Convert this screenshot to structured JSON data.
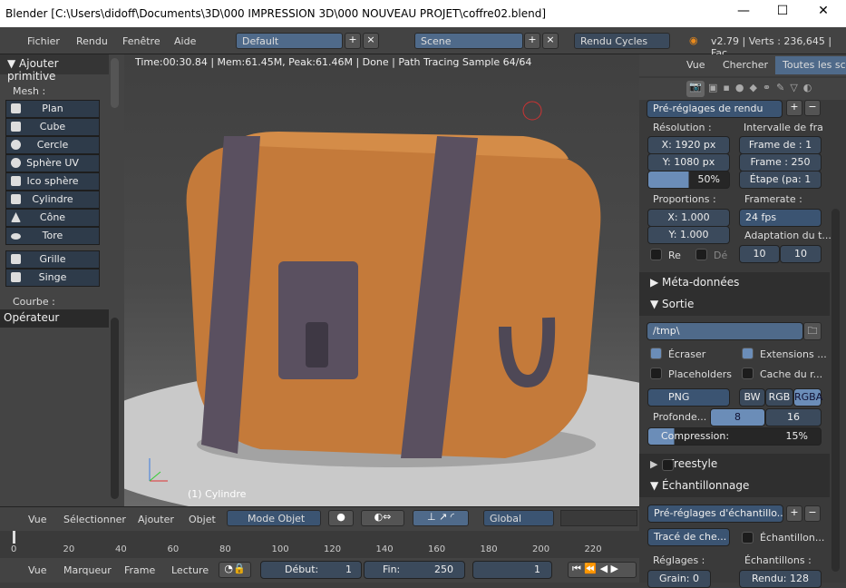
{
  "window": {
    "title": "Blender [C:\\Users\\didoff\\Documents\\3D\\000 IMPRESSION 3D\\000 NOUVEAU PROJET\\coffre02.blend]",
    "minimize": "—",
    "maximize": "☐",
    "close": "✕"
  },
  "topbar": {
    "menus": [
      "Fichier",
      "Rendu",
      "Fenêtre",
      "Aide"
    ],
    "layout": "Default",
    "scene": "Scene",
    "engine": "Rendu Cycles",
    "stats": "v2.79 | Verts : 236,645 | Fac"
  },
  "toolshelf": {
    "title": "▼ Ajouter primitive",
    "mesh_label": "Mesh :",
    "mesh_items": [
      "Plan",
      "Cube",
      "Cercle",
      "Sphère UV",
      "Ico sphère",
      "Cylindre",
      "Cône",
      "Tore"
    ],
    "extra_items": [
      "Grille",
      "Singe"
    ],
    "curve_label": "Courbe :",
    "operator": "Opérateur"
  },
  "viewport": {
    "render_info": "Time:00:30.84 | Mem:61.45M, Peak:61.46M | Done | Path Tracing Sample 64/64",
    "object_label": "(1) Cylindre"
  },
  "outliner": {
    "view": "Vue",
    "search": "Chercher",
    "all": "Toutes les scè"
  },
  "properties": {
    "presets": "Pré-réglages de rendu",
    "resolution_label": "Résolution :",
    "res_x": "X:  1920 px",
    "res_y": "Y:  1080 px",
    "res_pct": "50%",
    "res_pct_value": 50,
    "frame_range_label": "Intervalle de fra",
    "frame_start": "Frame de : 1",
    "frame_end": "Frame : 250",
    "frame_step": "Étape (pa: 1",
    "aspect_label": "Proportions :",
    "aspect_x": "X:        1.000",
    "aspect_y": "Y:        1.000",
    "framerate_label": "Framerate :",
    "framerate": "24 fps",
    "remap_label": "Adaptation du t...",
    "remap_old": "10",
    "remap_new": "10",
    "border": "Re",
    "crop": "Dé",
    "metadata": "▶ Méta-données",
    "output": "▼ Sortie",
    "path": "/tmp\\",
    "overwrite": "Écraser",
    "extensions": "Extensions ...",
    "placeholders": "Placeholders",
    "cache": "Cache du r...",
    "format": "PNG",
    "bw": "BW",
    "rgb": "RGB",
    "rgba": "RGBA",
    "depth_label": "Profonde...",
    "depth_8": "8",
    "depth_16": "16",
    "compression": "Compression:",
    "compression_value": "15%",
    "compression_pct": 15,
    "freestyle": "Freestyle",
    "sampling": "▼ Échantillonnage",
    "sampling_presets": "Pré-réglages d'échantillo...",
    "integrator": "Tracé de che...",
    "squared": "Échantillon...",
    "settings_label": "Réglages :",
    "samples_label": "Échantillons :",
    "seed": "Grain: 0",
    "render_samples": "Rendu: 128"
  },
  "view3d_header": {
    "menus": [
      "Vue",
      "Sélectionner",
      "Ajouter",
      "Objet"
    ],
    "mode": "Mode Objet",
    "orientation": "Global"
  },
  "timeline": {
    "ticks": [
      "0",
      "20",
      "40",
      "60",
      "80",
      "100",
      "120",
      "140",
      "160",
      "180",
      "200",
      "220"
    ],
    "current_frame": 0
  },
  "timeline_header": {
    "menus": [
      "Vue",
      "Marqueur",
      "Frame",
      "Lecture"
    ],
    "start": "Début:",
    "start_value": "1",
    "end": "Fin:",
    "end_value": "250",
    "current": "1"
  },
  "colors": {
    "accent": "#5680c2",
    "panel": "#3a3a3a",
    "header": "#434343",
    "chest": "#c47a3a",
    "band": "#5a5060"
  }
}
